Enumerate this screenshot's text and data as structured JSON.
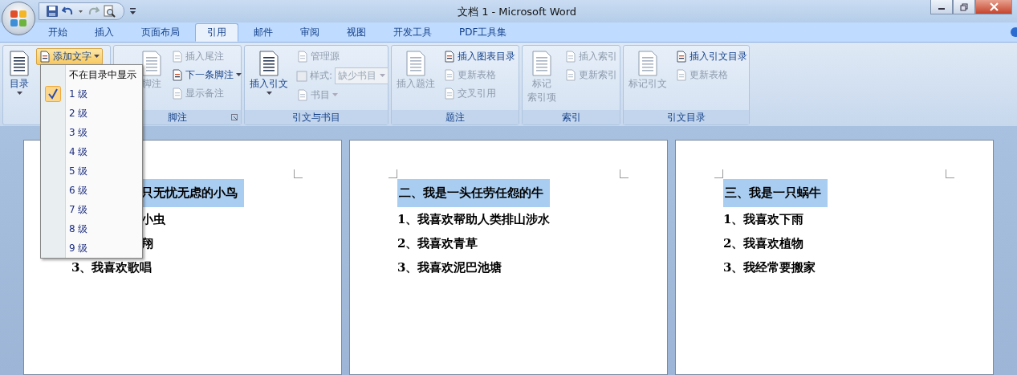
{
  "window": {
    "title": "文档 1 - Microsoft Word"
  },
  "tabs": [
    {
      "label": "开始",
      "selected": false
    },
    {
      "label": "插入",
      "selected": false
    },
    {
      "label": "页面布局",
      "selected": false
    },
    {
      "label": "引用",
      "selected": true
    },
    {
      "label": "邮件",
      "selected": false
    },
    {
      "label": "审阅",
      "selected": false
    },
    {
      "label": "视图",
      "selected": false
    },
    {
      "label": "开发工具",
      "selected": false
    },
    {
      "label": "PDF工具集",
      "selected": false
    }
  ],
  "ribbon_groups": [
    {
      "large": [
        {
          "lines": [
            "目录"
          ],
          "disabled": false,
          "dropdown": true
        }
      ],
      "small": [
        {
          "kind": "button",
          "label": "添加文字",
          "disabled": false,
          "dropdown": true,
          "pressed": true
        }
      ]
    },
    {
      "label": "脚注",
      "launcher": true,
      "large": [
        {
          "lines": [
            "脚注"
          ],
          "disabled": true,
          "covered": true
        }
      ],
      "small": [
        {
          "kind": "button",
          "label": "插入尾注",
          "disabled": true,
          "pressed": false
        },
        {
          "kind": "button",
          "label": "下一条脚注",
          "disabled": false,
          "dropdown": true,
          "pressed": false
        },
        {
          "kind": "button",
          "label": "显示备注",
          "disabled": true,
          "pressed": false
        }
      ]
    },
    {
      "label": "引文与书目",
      "large": [
        {
          "lines": [
            "插入引文"
          ],
          "disabled": false,
          "dropdown": true
        }
      ],
      "small": [
        {
          "kind": "button",
          "label": "管理源",
          "disabled": true,
          "pressed": false
        },
        {
          "kind": "combo",
          "label": "样式:",
          "value": "缺少书目",
          "disabled": true
        },
        {
          "kind": "button",
          "label": "书目",
          "disabled": true,
          "dropdown": true,
          "pressed": false
        }
      ]
    },
    {
      "label": "题注",
      "large": [
        {
          "lines": [
            "插入题注"
          ],
          "disabled": true
        }
      ],
      "small": [
        {
          "kind": "button",
          "label": "插入图表目录",
          "disabled": false,
          "pressed": false
        },
        {
          "kind": "button",
          "label": "更新表格",
          "disabled": true,
          "pressed": false
        },
        {
          "kind": "button",
          "label": "交叉引用",
          "disabled": true,
          "pressed": false
        }
      ]
    },
    {
      "label": "索引",
      "large": [
        {
          "lines": [
            "标记",
            "索引项"
          ],
          "disabled": true
        }
      ],
      "small": [
        {
          "kind": "button",
          "label": "插入索引",
          "disabled": true,
          "pressed": false
        },
        {
          "kind": "button",
          "label": "更新索引",
          "disabled": true,
          "pressed": false
        }
      ]
    },
    {
      "label": "引文目录",
      "large": [
        {
          "lines": [
            "标记引文"
          ],
          "disabled": true
        }
      ],
      "small": [
        {
          "kind": "button",
          "label": "插入引文目录",
          "disabled": false,
          "pressed": false
        },
        {
          "kind": "button",
          "label": "更新表格",
          "disabled": true,
          "pressed": false
        }
      ]
    }
  ],
  "menu": {
    "items": [
      {
        "label": "不在目录中显示",
        "selected": false
      },
      {
        "label": "1 级",
        "selected": true
      },
      {
        "label": "2 级",
        "selected": false
      },
      {
        "label": "3 级",
        "selected": false
      },
      {
        "label": "4 级",
        "selected": false
      },
      {
        "label": "5 级",
        "selected": false
      },
      {
        "label": "6 级",
        "selected": false
      },
      {
        "label": "7 级",
        "selected": false
      },
      {
        "label": "8 级",
        "selected": false
      },
      {
        "label": "9 级",
        "selected": false
      }
    ]
  },
  "pages": [
    {
      "lines": [
        {
          "text": "只无忧无虑的小鸟",
          "highlighted": true,
          "covered": true
        },
        {
          "text": "小虫",
          "highlighted": false,
          "covered": true
        },
        {
          "text": "翔",
          "highlighted": false,
          "covered": true
        },
        {
          "text": "3、我喜欢歌唱",
          "highlighted": false
        }
      ]
    },
    {
      "lines": [
        {
          "text": "二、我是一头任劳任怨的牛",
          "highlighted": true
        },
        {
          "text": "1、我喜欢帮助人类排山涉水",
          "highlighted": false
        },
        {
          "text": "2、我喜欢青草",
          "highlighted": false
        },
        {
          "text": "3、我喜欢泥巴池塘",
          "highlighted": false
        }
      ]
    },
    {
      "lines": [
        {
          "text": "三、我是一只蜗牛",
          "highlighted": true
        },
        {
          "text": "1、我喜欢下雨",
          "highlighted": false
        },
        {
          "text": "2、我喜欢植物",
          "highlighted": false
        },
        {
          "text": "3、我经常要搬家",
          "highlighted": false
        }
      ]
    }
  ]
}
